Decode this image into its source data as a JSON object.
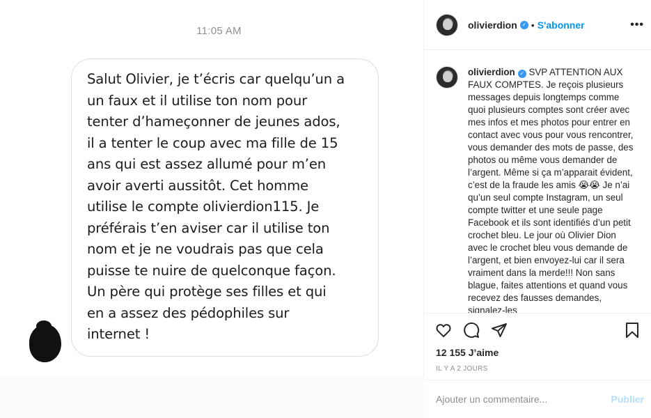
{
  "media": {
    "timestamp": "11:05 AM",
    "message": "Salut Olivier, je t’écris car quelqu’un a\nun faux et il utilise ton nom pour\ntenter d’hameçonner de jeunes ados,\nil a tenter le coup avec ma fille de 15\nans qui est assez allumé pour m’en\navoir averti aussitôt. Cet homme\nutilise le compte olivierdion115. Je\npréférais t’en aviser car il utilise ton\nnom et je ne voudrais pas que cela\npuisse te nuire de quelconque façon.\nUn père qui protège ses filles et qui\nen a assez des pédophiles sur\ninternet !"
  },
  "header": {
    "username": "olivierdion",
    "separator": "•",
    "follow_label": "S'abonner",
    "more_label": "•••"
  },
  "caption": {
    "username": "olivierdion",
    "text": " SVP ATTENTION AUX FAUX COMPTES. Je reçois plusieurs messages depuis longtemps comme quoi plusieurs comptes sont créer avec mes infos et mes photos pour entrer en contact avec vous pour vous rencontrer, vous demander des mots de passe, des photos ou même vous demander de l’argent. Même si ça m’apparait évident, c’est de la fraude les amis 😭😭 Je n’ai qu’un seul compte Instagram, un seul compte twitter et une seule page Facebook et ils sont identifiés d’un petit crochet bleu. Le jour où Olivier Dion avec le crochet bleu vous demande de l’argent, et bien envoyez-lui car il sera vraiment dans la merde!!! Non sans blague, faites attentions et quand vous recevez des fausses demandes, signalez-les"
  },
  "actions": {
    "icons": [
      "heart-icon",
      "comment-icon",
      "share-icon",
      "bookmark-icon"
    ],
    "likes": "12 155 J’aime",
    "posted": "IL Y A 2 JOURS"
  },
  "comment_box": {
    "placeholder": "Ajouter un commentaire...",
    "post_label": "Publier"
  },
  "colors": {
    "accent": "#0095f6",
    "verified": "#3897f0",
    "post_disabled": "#b2dffc",
    "border": "#efefef"
  }
}
